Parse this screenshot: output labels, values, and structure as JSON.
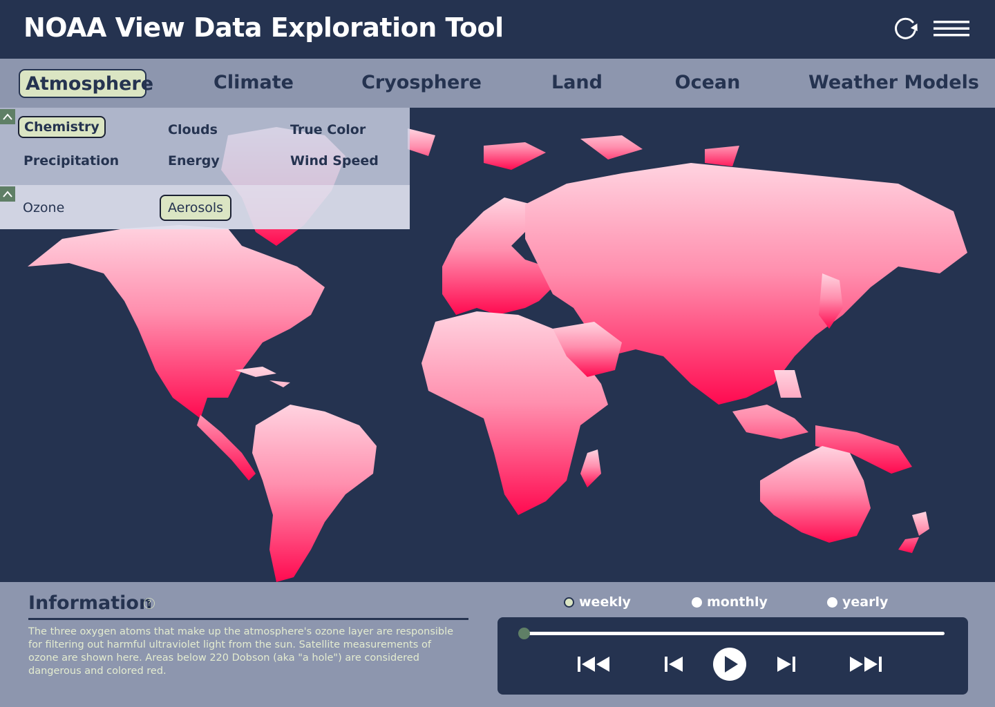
{
  "app": {
    "title": "NOAA View Data Exploration Tool"
  },
  "header": {
    "refresh_icon": "refresh-icon",
    "menu_icon": "hamburger-menu-icon"
  },
  "tabs": [
    {
      "label": "Atmosphere",
      "active": true
    },
    {
      "label": "Climate",
      "active": false
    },
    {
      "label": "Cryosphere",
      "active": false
    },
    {
      "label": "Land",
      "active": false
    },
    {
      "label": "Ocean",
      "active": false
    },
    {
      "label": "Weather Models",
      "active": false
    }
  ],
  "subcategories": [
    {
      "label": "Chemistry",
      "active": true
    },
    {
      "label": "Clouds",
      "active": false
    },
    {
      "label": "True Color",
      "active": false
    },
    {
      "label": "Precipitation",
      "active": false
    },
    {
      "label": "Energy",
      "active": false
    },
    {
      "label": "Wind Speed",
      "active": false
    }
  ],
  "variables": [
    {
      "label": "Ozone",
      "active": false
    },
    {
      "label": "Aerosols",
      "active": true
    }
  ],
  "info": {
    "title": "Information",
    "help_icon": "?",
    "text": "The three oxygen atoms that make up the atmosphere's ozone layer are responsible for filtering out harmful ultraviolet light from the sun. Satellite measurements of ozone are shown here. Areas below 220 Dobson (aka \"a hole\") are considered dangerous and colored red."
  },
  "time_scale": {
    "options": [
      {
        "label": "weekly",
        "selected": true
      },
      {
        "label": "monthly",
        "selected": false
      },
      {
        "label": "yearly",
        "selected": false
      }
    ]
  },
  "player": {
    "progress": 0,
    "controls": [
      "skip-to-start-icon",
      "step-back-icon",
      "play-icon",
      "step-forward-icon",
      "skip-to-end-icon"
    ]
  },
  "colors": {
    "navy": "#253350",
    "slate": "#8d96ae",
    "accent_green": "#dbe5c3",
    "thumb_green": "#5f7f66",
    "map_gradient_top": "#ffd3e0",
    "map_gradient_bottom": "#ff0a50"
  }
}
